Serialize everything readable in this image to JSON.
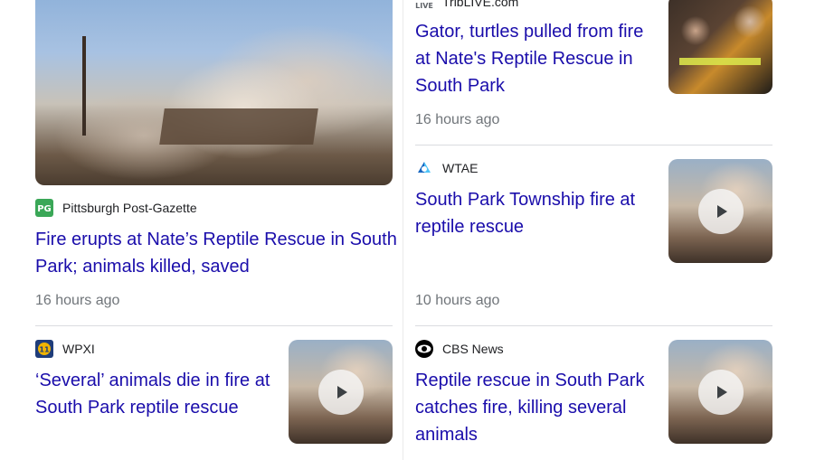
{
  "cards": [
    {
      "source": "TribLIVE.com",
      "headline": "Gator, turtles pulled from fire at Nate's Reptile Rescue in South Park",
      "time": "16 hours ago"
    },
    {
      "source": "Pittsburgh Post-Gazette",
      "headline": "Fire erupts at Nate’s Reptile Rescue in South Park; animals killed, saved",
      "time": "16 hours ago"
    },
    {
      "source": "WTAE",
      "headline": "South Park Township fire at reptile rescue",
      "time": "10 hours ago",
      "has_video": true
    },
    {
      "source": "WPXI",
      "headline": "‘Several’ animals die in fire at South Park reptile rescue",
      "has_video": true
    },
    {
      "source": "CBS News",
      "headline": "Reptile rescue in South Park catches fire, killing several animals",
      "has_video": true
    }
  ],
  "colors": {
    "link": "#1a0dab",
    "meta": "#70757a",
    "divider": "#dadce0"
  },
  "icons": {
    "play": "play-icon",
    "triblive": "live-logo-icon",
    "pg": "pg-logo-icon",
    "wtae": "wtae-logo-icon",
    "wpxi": "wpxi-logo-icon",
    "cbs": "cbs-eye-logo-icon"
  }
}
